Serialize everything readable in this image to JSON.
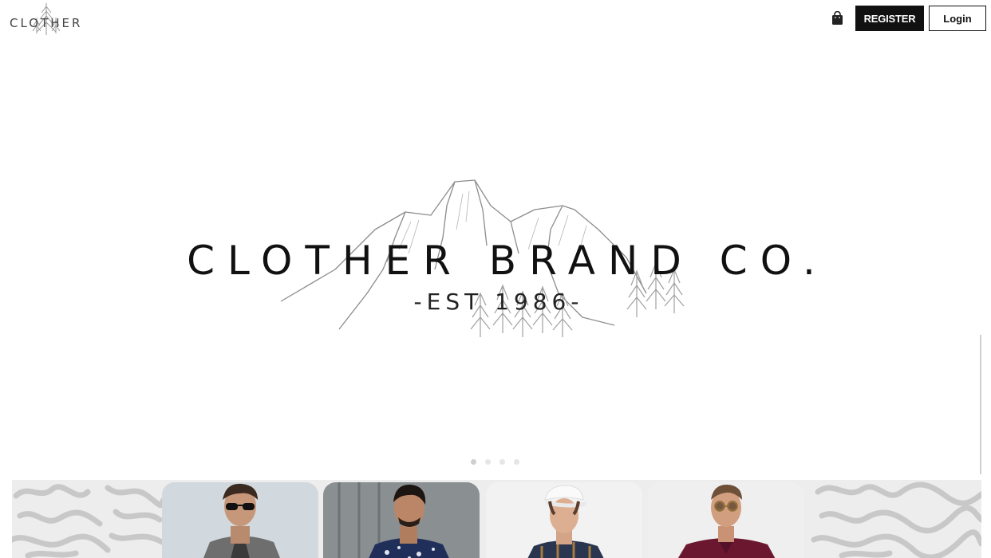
{
  "header": {
    "logo_text": "CLOTHER",
    "cart_icon": "shopping-bag-icon",
    "register_label": "REGISTER",
    "login_label": "Login"
  },
  "hero": {
    "title": "CLOTHER BRAND CO.",
    "subtitle": "-EST 1986-",
    "slides": 4,
    "active_slide": 1
  },
  "products": [
    {
      "name": "model-sunglasses-grey-jacket",
      "bg": "#c9d0d6",
      "shirt": "#6e6e6e"
    },
    {
      "name": "model-floral-navy-shirt",
      "bg": "#7d8285",
      "shirt": "#1f2f5a"
    },
    {
      "name": "model-white-cap-plaid-shirt",
      "bg": "#f1f1f1",
      "shirt": "#2a3550"
    },
    {
      "name": "model-sunglasses-maroon-shirt",
      "bg": "#f0f0f0",
      "shirt": "#6b1730"
    }
  ],
  "colors": {
    "accent": "#111111",
    "background": "#ffffff",
    "pattern": "#c8c8c8"
  }
}
